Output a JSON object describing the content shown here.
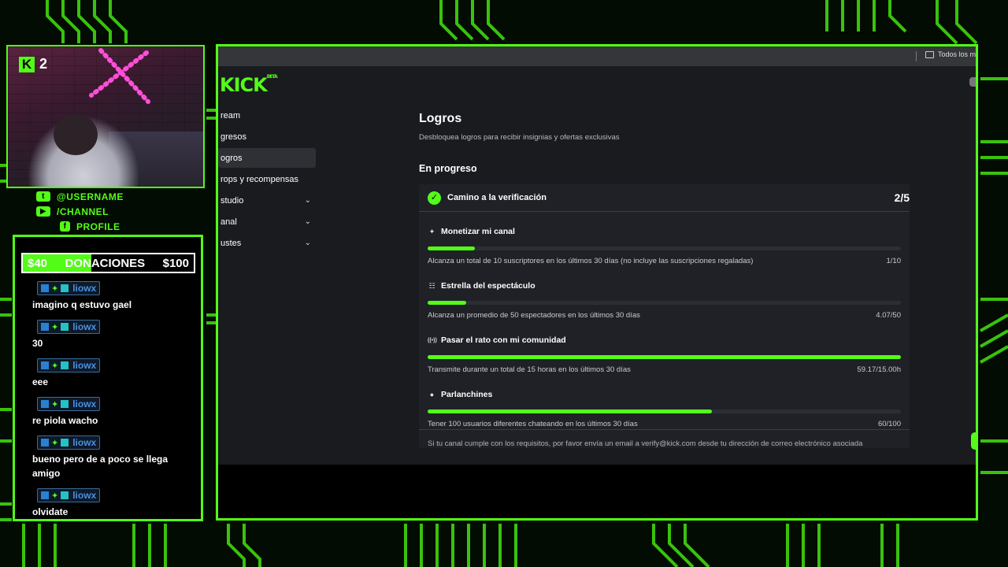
{
  "webcam": {
    "platform_badge": "K",
    "viewer_count": "2"
  },
  "socials": [
    {
      "icon": "twitter-icon",
      "glyph": "t",
      "label": "@USERNAME"
    },
    {
      "icon": "youtube-icon",
      "glyph": "▶",
      "label": "/CHANNEL"
    },
    {
      "icon": "facebook-icon",
      "glyph": "f",
      "label": "PROFILE"
    }
  ],
  "donations": {
    "current": "$40",
    "label": "DONACIONES",
    "goal": "$100",
    "progress": 0.4
  },
  "chat": [
    {
      "user": "liowx",
      "text": "imagino q estuvo gael"
    },
    {
      "user": "liowx",
      "text": "30"
    },
    {
      "user": "liowx",
      "text": "eee"
    },
    {
      "user": "liowx",
      "text": "re piola wacho"
    },
    {
      "user": "liowx",
      "text": "bueno pero de a poco se llega amigo"
    },
    {
      "user": "liowx",
      "text": "olvidate"
    }
  ],
  "browser": {
    "bookmark": "Todos los ma"
  },
  "kick": {
    "logo": "KICK",
    "logo_tag": "BETA",
    "nav": [
      {
        "label": "ream",
        "active": false,
        "chevron": false
      },
      {
        "label": "gresos",
        "active": false,
        "chevron": false
      },
      {
        "label": "ogros",
        "active": true,
        "chevron": false
      },
      {
        "label": "rops y recompensas",
        "active": false,
        "chevron": false
      },
      {
        "label": "studio",
        "active": false,
        "chevron": true
      },
      {
        "label": "anal",
        "active": false,
        "chevron": true
      },
      {
        "label": "ustes",
        "active": false,
        "chevron": true
      }
    ],
    "page_title": "Logros",
    "page_subtitle": "Desbloquea logros para recibir insignias y ofertas exclusivas",
    "section_title": "En progreso",
    "card": {
      "title": "Camino a la verificación",
      "count": "2/5",
      "goals": [
        {
          "icon": "sparkle-icon",
          "glyph": "✦",
          "title": "Monetizar mi canal",
          "desc": "Alcanza un total de 10 suscriptores en los últimos 30 días (no incluye las suscripciones regaladas)",
          "value": "1/10",
          "progress": 0.1
        },
        {
          "icon": "viewers-icon",
          "glyph": "☷",
          "title": "Estrella del espectáculo",
          "desc": "Alcanza un promedio de 50 espectadores en los últimos 30 días",
          "value": "4.07/50",
          "progress": 0.0814
        },
        {
          "icon": "broadcast-icon",
          "glyph": "((•))",
          "title": "Pasar el rato con mi comunidad",
          "desc": "Transmite durante un total de 15 horas en los últimos 30 días",
          "value": "59.17/15.00h",
          "progress": 1.0
        },
        {
          "icon": "chat-bubble-icon",
          "glyph": "●",
          "title": "Parlanchines",
          "desc": "Tener 100 usuarios diferentes chateando en los últimos 30 días",
          "value": "60/100",
          "progress": 0.6
        }
      ],
      "footer": "Si tu canal cumple con los requisitos, por favor envía un email a verify@kick.com desde tu dirección de correo electrónico asociada"
    }
  },
  "colors": {
    "accent": "#53fc18",
    "page_bg": "#191b1f",
    "card_bg": "#1f2126",
    "username": "#4d8fe0"
  }
}
